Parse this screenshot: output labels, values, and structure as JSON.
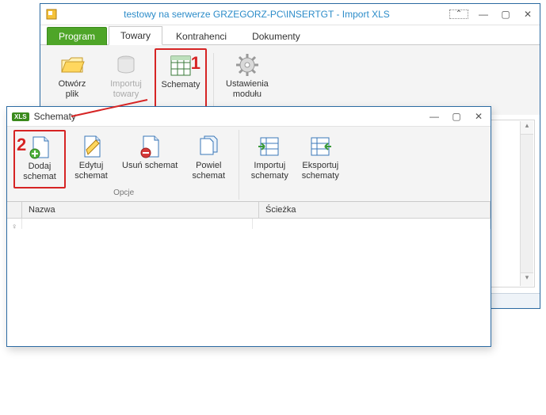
{
  "main": {
    "title": "testowy na serwerze GRZEGORZ-PC\\INSERTGT - Import XLS",
    "tabs": {
      "program": "Program",
      "towary": "Towary",
      "kontrahenci": "Kontrahenci",
      "dokumenty": "Dokumenty"
    },
    "ribbon": {
      "otworz_plik": "Otwórz\nplik",
      "importuj_towary": "Importuj\ntowary",
      "schematy": "Schematy",
      "ustawienia_modulu": "Ustawienia\nmodułu"
    }
  },
  "sec": {
    "badge": "XLS",
    "title": "Schematy",
    "ribbon": {
      "dodaj": "Dodaj\nschemat",
      "edytuj": "Edytuj\nschemat",
      "usun": "Usuń schemat",
      "powiel": "Powiel\nschemat",
      "importuj": "Importuj\nschematy",
      "eksportuj": "Eksportuj\nschematy",
      "group_label": "Opcje"
    },
    "grid": {
      "col_nazwa": "Nazwa",
      "col_sciezka": "Ścieżka",
      "filter_glyph": "♀"
    }
  },
  "callouts": {
    "one": "1",
    "two": "2"
  },
  "glyphs": {
    "collapse": "⌃",
    "minimize": "—",
    "maximize": "▢",
    "close": "✕",
    "up": "▴",
    "down": "▾"
  }
}
